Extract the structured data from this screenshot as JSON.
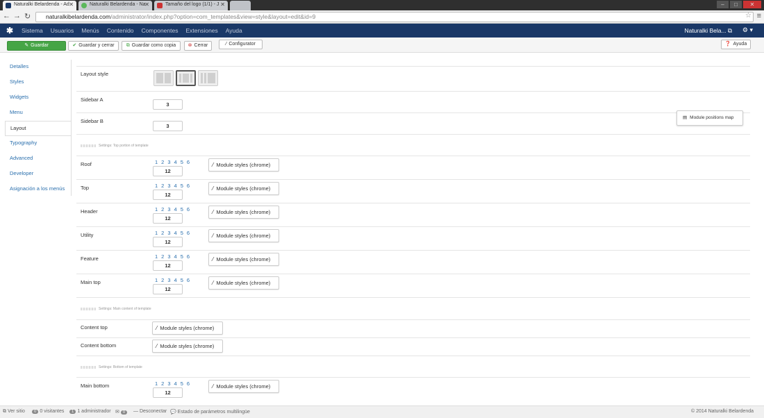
{
  "browser": {
    "tabs": [
      {
        "label": "Naturalki Belardenda - Ad",
        "active": true
      },
      {
        "label": "Naturalki Belardenda - Na",
        "active": false
      },
      {
        "label": "Tamaño del logo (1/1) - J",
        "active": false
      }
    ],
    "url_host": "naturalkibelardenda.com",
    "url_path": "/administrator/index.php?option=com_templates&view=style&layout=edit&id=9"
  },
  "topnav": {
    "items": [
      "Sistema",
      "Usuarios",
      "Menús",
      "Contenido",
      "Componentes",
      "Extensiones",
      "Ayuda"
    ],
    "site_name": "Naturalki Bela..."
  },
  "toolbar": {
    "save": "Guardar",
    "save_close": "Guardar y cerrar",
    "save_copy": "Guardar como copia",
    "close": "Cerrar",
    "configurator": "Configurator",
    "help": "Ayuda"
  },
  "sidebar": {
    "items": [
      "Detalles",
      "Styles",
      "Widgets",
      "Menu",
      "Layout",
      "Typography",
      "Advanced",
      "Developer",
      "Asignación a los menús"
    ],
    "active_index": 4
  },
  "layout": {
    "layout_style_label": "Layout style",
    "layout_style_selected": 2,
    "sidebar_a_label": "Sidebar A",
    "sidebar_a_value": "3",
    "sidebar_b_label": "Sidebar B",
    "sidebar_b_value": "3",
    "position_map_button": "Module positions map",
    "section_top": "Settings: Top portion of template",
    "section_main": "Settings: Main content of template",
    "section_bottom": "Settings: Bottom of template",
    "column_options": [
      "1",
      "2",
      "3",
      "4",
      "5",
      "6"
    ],
    "module_styles_label": "Module styles (chrome)",
    "positions": [
      {
        "label": "Roof",
        "value": "12"
      },
      {
        "label": "Top",
        "value": "12"
      },
      {
        "label": "Header",
        "value": "12"
      },
      {
        "label": "Utility",
        "value": "12"
      },
      {
        "label": "Feature",
        "value": "12"
      },
      {
        "label": "Main top",
        "value": "12"
      }
    ],
    "content_top_label": "Content top",
    "content_bottom_label": "Content bottom",
    "main_bottom_label": "Main bottom",
    "main_bottom_value": "12"
  },
  "status": {
    "view_site": "Ver sitio",
    "visitors_count": "0",
    "visitors": "0 visitantes",
    "admins_count": "1",
    "admins": "1 administrador",
    "messages_count": "0",
    "logout": "Desconectar",
    "multilang": "Estado de parámetros multilingüe",
    "copyright": "© 2014 Naturalki Belardenda"
  },
  "colors": {
    "nav_bg": "#1a3867",
    "save_btn": "#46a546",
    "link": "#2a6fad"
  }
}
